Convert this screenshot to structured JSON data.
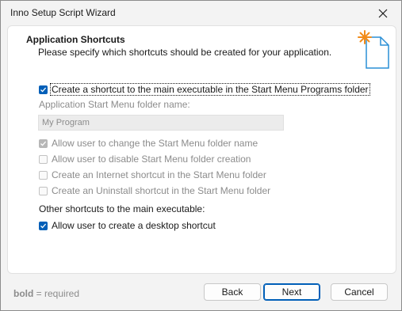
{
  "window": {
    "title": "Inno Setup Script Wizard",
    "close_icon": "close-icon"
  },
  "header": {
    "title": "Application Shortcuts",
    "subtitle": "Please specify which shortcuts should be created for your application.",
    "icon": "wizard-sparkle-document-icon"
  },
  "options": {
    "start_menu_shortcut": {
      "label": "Create a shortcut to the main executable in the Start Menu Programs folder",
      "checked": true
    },
    "folder_name_label": "Application Start Menu folder name:",
    "folder_name_value": "My Program",
    "allow_change_folder": {
      "label": "Allow user to change the Start Menu folder name",
      "checked": true,
      "disabled": true
    },
    "allow_disable_folder": {
      "label": "Allow user to disable Start Menu folder creation",
      "checked": false,
      "disabled": true
    },
    "internet_shortcut": {
      "label": "Create an Internet shortcut in the Start Menu folder",
      "checked": false,
      "disabled": true
    },
    "uninstall_shortcut": {
      "label": "Create an Uninstall shortcut in the Start Menu folder",
      "checked": false,
      "disabled": true
    },
    "other_shortcuts_label": "Other shortcuts to the main executable:",
    "desktop_shortcut": {
      "label": "Allow user to create a desktop shortcut",
      "checked": true
    }
  },
  "footer": {
    "note_bold": "bold",
    "note_rest": " = required",
    "back_label": "Back",
    "next_label": "Next",
    "cancel_label": "Cancel"
  },
  "colors": {
    "accent": "#005fb8",
    "disabled_text": "#8c8c8c",
    "sparkle": "#f28c1a",
    "doc_outline": "#2a8fd6"
  }
}
